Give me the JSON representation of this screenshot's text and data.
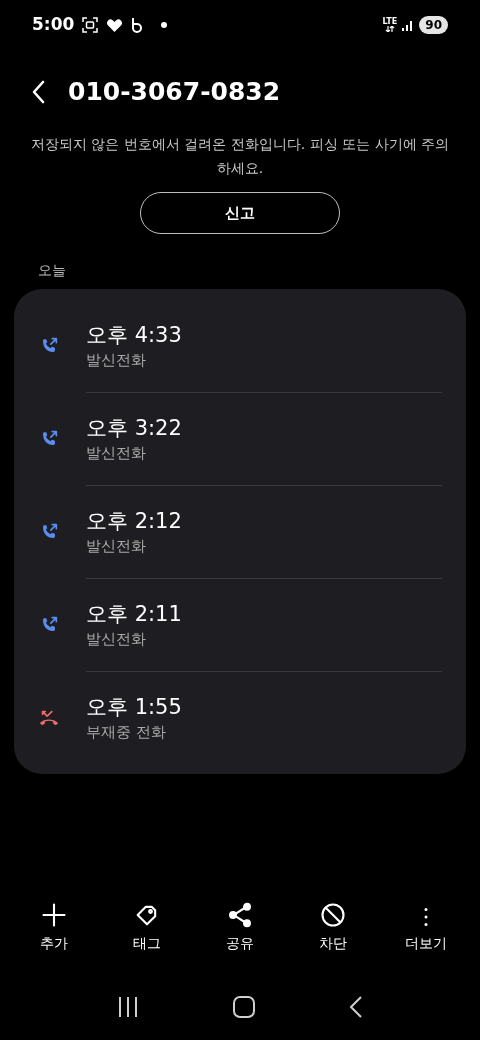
{
  "status_bar": {
    "time": "5:00",
    "network": "LTE",
    "battery": "90"
  },
  "header": {
    "title": "010-3067-0832"
  },
  "warning": {
    "text": "저장되지 않은 번호에서 걸려온 전화입니다. 피싱 또는 사기에 주의하세요.",
    "button": "신고"
  },
  "section": "오늘",
  "calls": [
    {
      "kind": "outgoing",
      "time": "오후 4:33",
      "type": "발신전화"
    },
    {
      "kind": "outgoing",
      "time": "오후 3:22",
      "type": "발신전화"
    },
    {
      "kind": "outgoing",
      "time": "오후 2:12",
      "type": "발신전화"
    },
    {
      "kind": "outgoing",
      "time": "오후 2:11",
      "type": "발신전화"
    },
    {
      "kind": "missed",
      "time": "오후 1:55",
      "type": "부재중 전화"
    }
  ],
  "actions": [
    {
      "kind": "add",
      "label": "추가"
    },
    {
      "kind": "tag",
      "label": "태그"
    },
    {
      "kind": "share",
      "label": "공유"
    },
    {
      "kind": "block",
      "label": "차단"
    },
    {
      "kind": "more",
      "label": "더보기"
    }
  ]
}
